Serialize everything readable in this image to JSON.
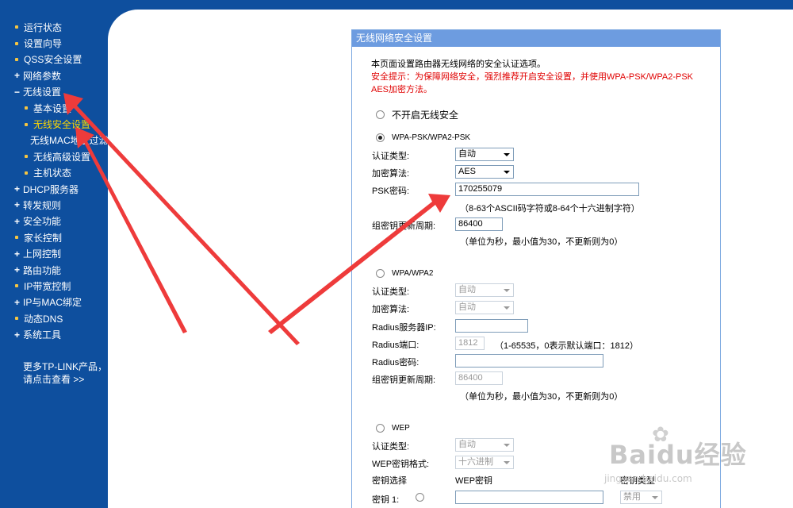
{
  "sidebar": {
    "items": [
      {
        "label": "运行状态",
        "type": "dot",
        "level": 0
      },
      {
        "label": "设置向导",
        "type": "dot",
        "level": 0
      },
      {
        "label": "QSS安全设置",
        "type": "dot",
        "level": 0
      },
      {
        "label": "网络参数",
        "type": "plus",
        "level": 0
      },
      {
        "label": "无线设置",
        "type": "minus",
        "level": 0
      },
      {
        "label": "基本设置",
        "type": "dot",
        "level": 1
      },
      {
        "label": "无线安全设置",
        "type": "dot",
        "level": 1,
        "active": true
      },
      {
        "label": "无线MAC地址过滤",
        "type": "dot",
        "level": 1
      },
      {
        "label": "无线高级设置",
        "type": "dot",
        "level": 1
      },
      {
        "label": "主机状态",
        "type": "dot",
        "level": 1
      },
      {
        "label": "DHCP服务器",
        "type": "plus",
        "level": 0
      },
      {
        "label": "转发规则",
        "type": "plus",
        "level": 0
      },
      {
        "label": "安全功能",
        "type": "plus",
        "level": 0
      },
      {
        "label": "家长控制",
        "type": "dot",
        "level": 0
      },
      {
        "label": "上网控制",
        "type": "plus",
        "level": 0
      },
      {
        "label": "路由功能",
        "type": "plus",
        "level": 0
      },
      {
        "label": "IP带宽控制",
        "type": "dot",
        "level": 0
      },
      {
        "label": "IP与MAC绑定",
        "type": "plus",
        "level": 0
      },
      {
        "label": "动态DNS",
        "type": "dot",
        "level": 0
      },
      {
        "label": "系统工具",
        "type": "plus",
        "level": 0
      }
    ],
    "promo_line1": "更多TP-LINK产品，",
    "promo_line2": "请点击查看 >>"
  },
  "panel": {
    "title": "无线网络安全设置",
    "description": "本页面设置路由器无线网络的安全认证选项。",
    "warning": "安全提示：为保障网络安全，强烈推荐开启安全设置，并使用WPA-PSK/WPA2-PSK AES加密方法。",
    "no_security_label": "不开启无线安全",
    "wpa_psk": {
      "label": "WPA-PSK/WPA2-PSK",
      "auth_label": "认证类型:",
      "auth_value": "自动",
      "enc_label": "加密算法:",
      "enc_value": "AES",
      "psk_label": "PSK密码:",
      "psk_value": "170255079",
      "psk_hint": "（8-63个ASCII码字符或8-64个十六进制字符）",
      "renew_label": "组密钥更新周期:",
      "renew_value": "86400",
      "renew_hint": "（单位为秒，最小值为30，不更新则为0）"
    },
    "wpa": {
      "label": "WPA/WPA2",
      "auth_label": "认证类型:",
      "auth_value": "自动",
      "enc_label": "加密算法:",
      "enc_value": "自动",
      "radius_ip_label": "Radius服务器IP:",
      "radius_ip_value": "",
      "radius_port_label": "Radius端口:",
      "radius_port_value": "1812",
      "radius_port_hint": "（1-65535，0表示默认端口：1812）",
      "radius_pwd_label": "Radius密码:",
      "radius_pwd_value": "",
      "renew_label": "组密钥更新周期:",
      "renew_value": "86400",
      "renew_hint": "（单位为秒，最小值为30，不更新则为0）"
    },
    "wep": {
      "label": "WEP",
      "auth_label": "认证类型:",
      "auth_value": "自动",
      "format_label": "WEP密钥格式:",
      "format_value": "十六进制",
      "key_select_header": "密钥选择",
      "wep_key_header": "WEP密钥",
      "key_type_header": "密钥类型",
      "key1_label": "密钥 1:",
      "key1_type": "禁用"
    }
  },
  "watermark": {
    "text": "Baidu经验",
    "url": "jingyan.baidu.com"
  },
  "colors": {
    "sidebar_bg": "#0e4f9e",
    "panel_title_bg": "#6d9ce0",
    "warning": "#e00000",
    "active_menu": "#ffd800",
    "arrow": "#ee3b3b"
  }
}
